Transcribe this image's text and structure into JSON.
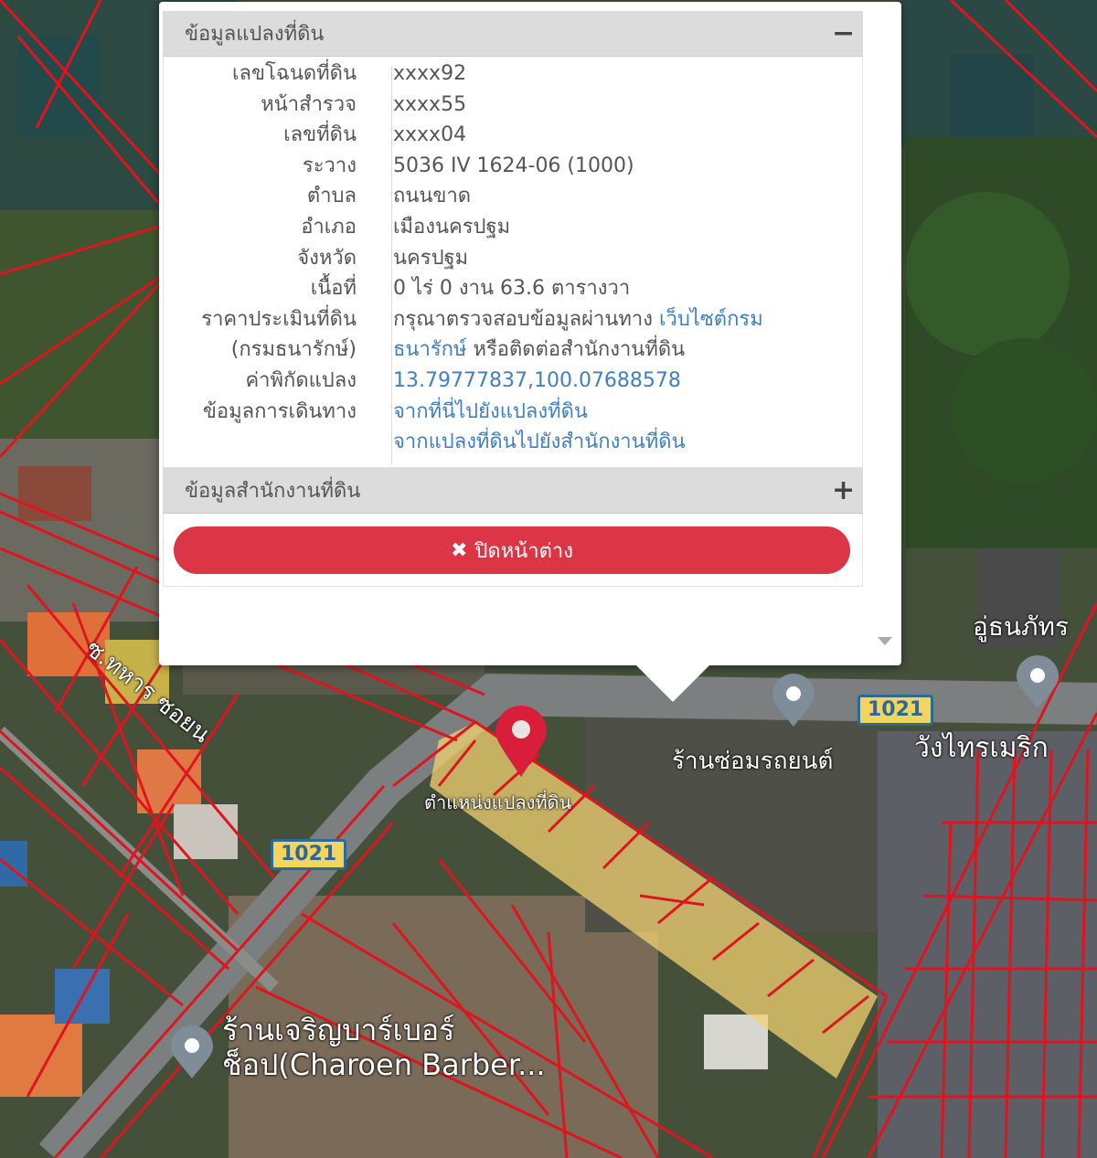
{
  "popup": {
    "panel1_title": "ข้อมูลแปลงที่ดิน",
    "panel1_toggle": "−",
    "panel2_title": "ข้อมูลสำนักงานที่ดิน",
    "panel2_toggle": "+",
    "close_label": "ปิดหน้าต่าง",
    "rows": [
      {
        "label": "เลขโฉนดที่ดิน",
        "value": "xxxx92"
      },
      {
        "label": "หน้าสำรวจ",
        "value": "xxxx55"
      },
      {
        "label": "เลขที่ดิน",
        "value": "xxxx04"
      },
      {
        "label": "ระวาง",
        "value": "5036 IV 1624-06 (1000)"
      },
      {
        "label": "ตำบล",
        "value": "ถนนขาด"
      },
      {
        "label": "อำเภอ",
        "value": "เมืองนครปฐม"
      },
      {
        "label": "จังหวัด",
        "value": "นครปฐม"
      },
      {
        "label": "เนื้อที่",
        "value": "0 ไร่ 0 งาน 63.6 ตารางวา"
      }
    ],
    "price": {
      "label1": "ราคาประเมินที่ดิน",
      "label2": "(กรมธนารักษ์)",
      "text1": "กรุณาตรวจสอบข้อมูลผ่านทาง ",
      "link1": "เว็บไซต์กรม",
      "link2": "ธนารักษ์",
      "text2": " หรือติดต่อสำนักงานที่ดิน"
    },
    "coord": {
      "label": "ค่าพิกัดแปลง",
      "value": "13.79777837,100.07688578"
    },
    "nav": {
      "label": "ข้อมูลการเดินทาง",
      "link1": "จากที่นี่ไปยังแปลงที่ดิน",
      "link2": "จากแปลงที่ดินไปยังสำนักงานที่ดิน"
    }
  },
  "map": {
    "parcel_marker_label": "ตำแหน่งแปลงที่ดิน",
    "road_badge_1": "1021",
    "road_badge_2": "1021",
    "poi_labels": {
      "repair_shop": "ร้านซ่อมรถยนต์",
      "top_right": "อู่ธนภัทร",
      "right_place": "วังไทรเมริก",
      "barber_line1": "ร้านเจริญบาร์เบอร์",
      "barber_line2": "ช็อป(Charoen Barber...",
      "street_top_left": "ซ.ทหาร ซอยน"
    },
    "colors": {
      "parcel_lines": "#e0141e",
      "highlight": "#f2d272",
      "marker": "#d81e3a",
      "close_button": "#dc3545"
    }
  }
}
